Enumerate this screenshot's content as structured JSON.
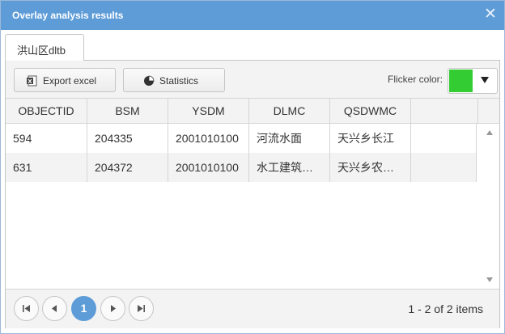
{
  "window": {
    "title": "Overlay analysis results",
    "close_icon": "close-icon"
  },
  "tab": {
    "label": "洪山区dltb"
  },
  "toolbar": {
    "export_label": "Export excel",
    "export_icon": "excel-icon",
    "statistics_label": "Statistics",
    "statistics_icon": "pie-chart-icon",
    "flicker_label": "Flicker color:",
    "flicker_color": "#33cc33"
  },
  "table": {
    "columns": [
      "OBJECTID",
      "BSM",
      "YSDM",
      "DLMC",
      "QSDWMC"
    ],
    "rows": [
      [
        "594",
        "204335",
        "2001010100",
        "河流水面",
        "天兴乡长江"
      ],
      [
        "631",
        "204372",
        "2001010100",
        "水工建筑…",
        "天兴乡农…"
      ]
    ]
  },
  "pager": {
    "current_page": "1",
    "info": "1 - 2 of 2 items"
  },
  "colors": {
    "accent": "#5e9cd7",
    "header_bg": "#f3f3f3",
    "alt_row": "#f3f3f3"
  }
}
